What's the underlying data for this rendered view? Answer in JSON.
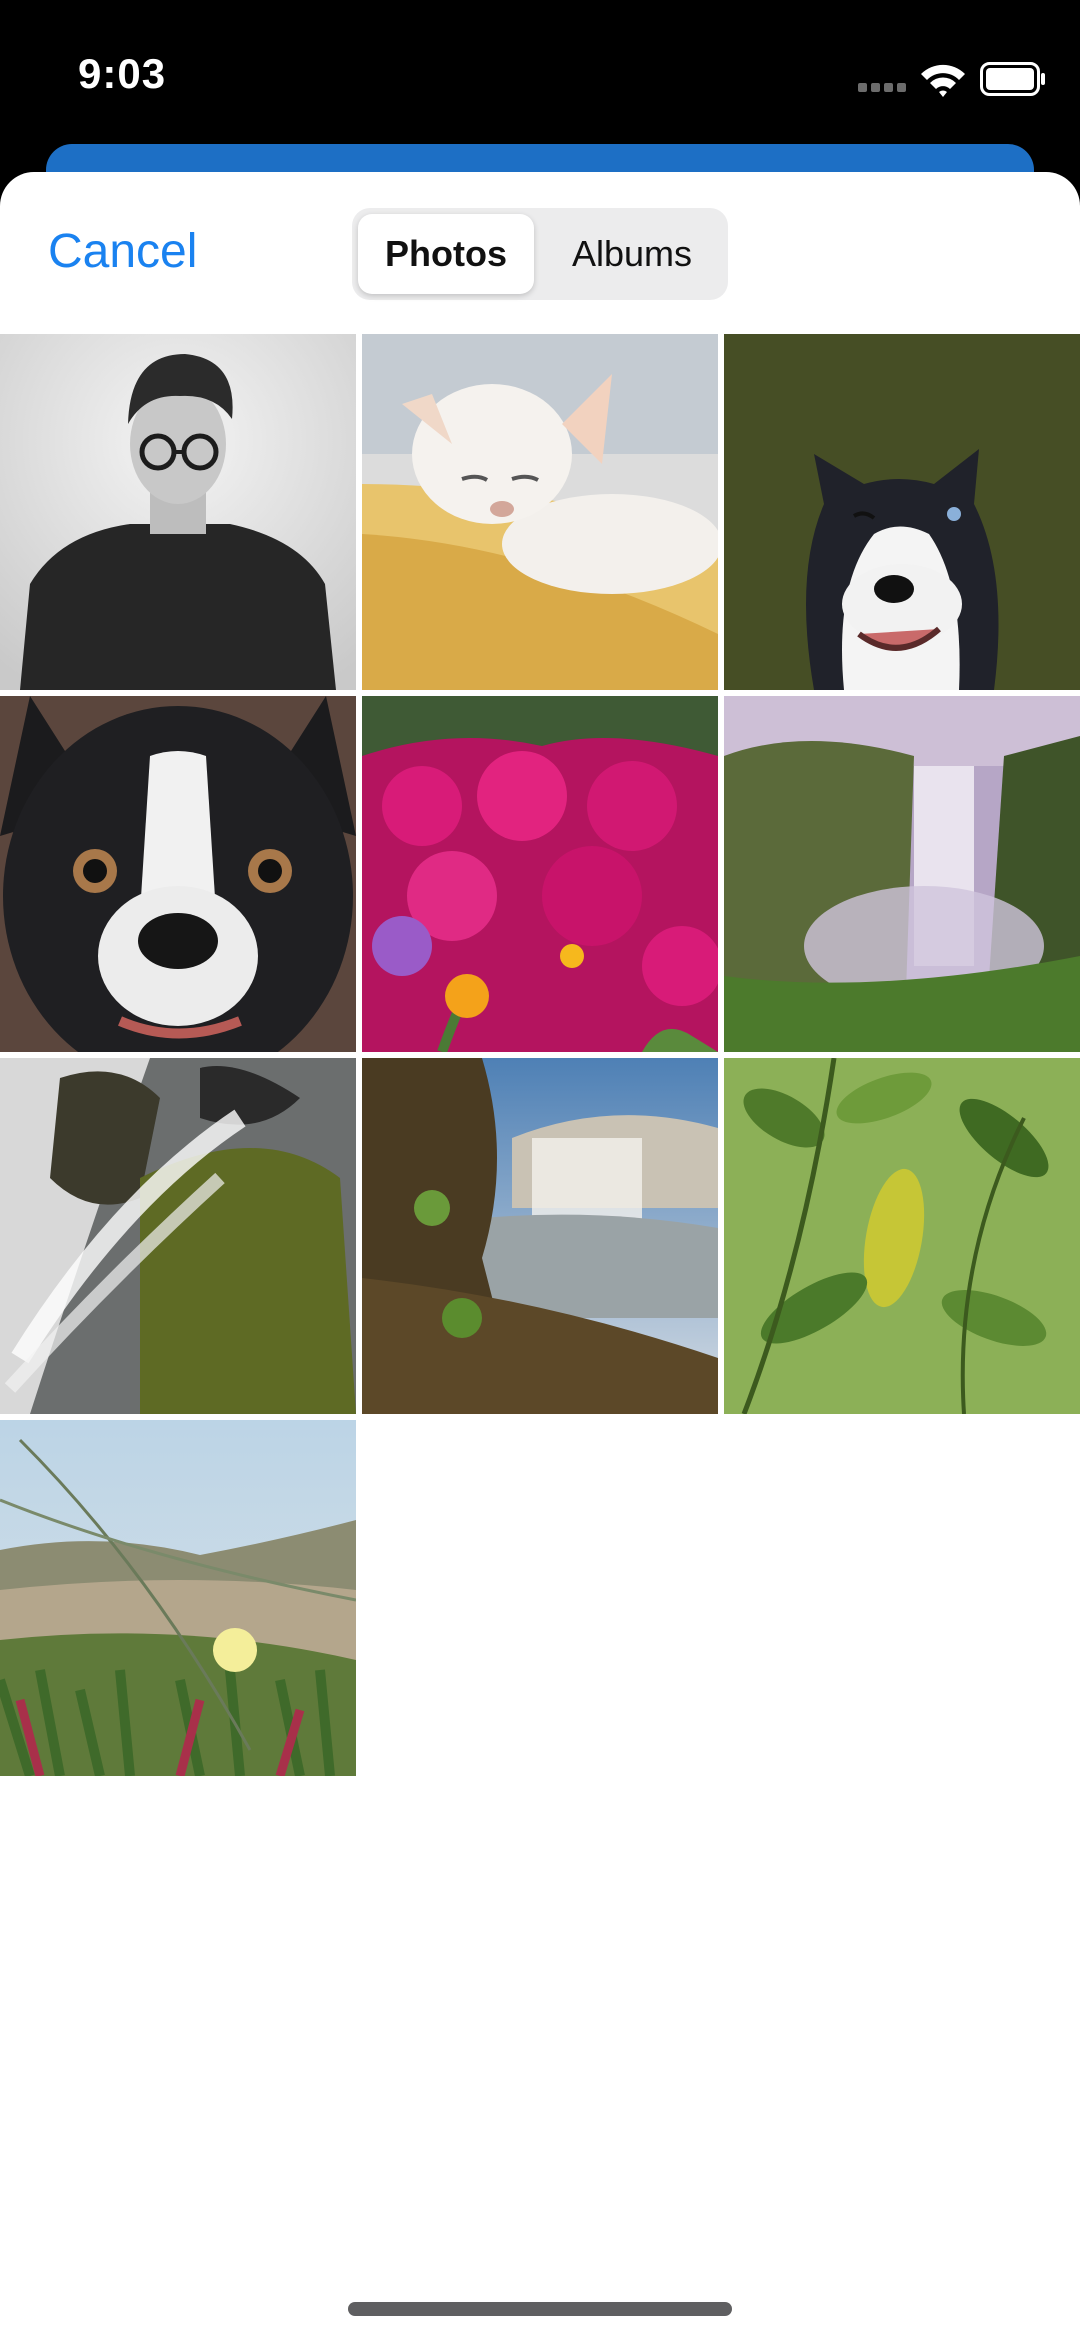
{
  "status_bar": {
    "time": "9:03",
    "icons": [
      "signal-icon",
      "wifi-icon",
      "battery-icon"
    ]
  },
  "header": {
    "cancel_label": "Cancel",
    "tabs": [
      {
        "label": "Photos",
        "selected": true
      },
      {
        "label": "Albums",
        "selected": false
      }
    ]
  },
  "colors": {
    "accent": "#1a82f0",
    "behind_sheet": "#1d6fc5"
  },
  "photos": [
    {
      "subject": "portrait-man-glasses"
    },
    {
      "subject": "white-chihuahua"
    },
    {
      "subject": "husky-winking"
    },
    {
      "subject": "boston-terrier"
    },
    {
      "subject": "magenta-flowers"
    },
    {
      "subject": "waterfall-cliff"
    },
    {
      "subject": "cascade-mossy-rock"
    },
    {
      "subject": "waterfall-shoreline"
    },
    {
      "subject": "green-leaves"
    },
    {
      "subject": "dune-grass-flower"
    }
  ]
}
